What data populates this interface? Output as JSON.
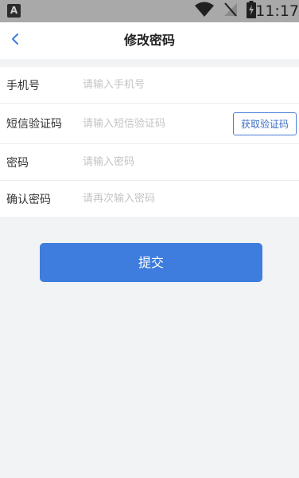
{
  "status_bar": {
    "app_icon_letter": "A",
    "time": "11:17",
    "icons": [
      "wifi-icon",
      "no-signal-icon",
      "battery-charging-icon"
    ]
  },
  "header": {
    "back_icon": "chevron-left-icon",
    "title": "修改密码"
  },
  "form": {
    "phone": {
      "label": "手机号",
      "placeholder": "请输入手机号",
      "value": ""
    },
    "sms_code": {
      "label": "短信验证码",
      "placeholder": "请输入短信验证码",
      "value": "",
      "button_label": "获取验证码"
    },
    "password": {
      "label": "密码",
      "placeholder": "请输入密码",
      "value": ""
    },
    "confirm_password": {
      "label": "确认密码",
      "placeholder": "请再次输入密码",
      "value": ""
    }
  },
  "submit_label": "提交",
  "colors": {
    "accent": "#3e7ddd",
    "background": "#f2f3f5",
    "status_bar": "#a9a9a9"
  }
}
